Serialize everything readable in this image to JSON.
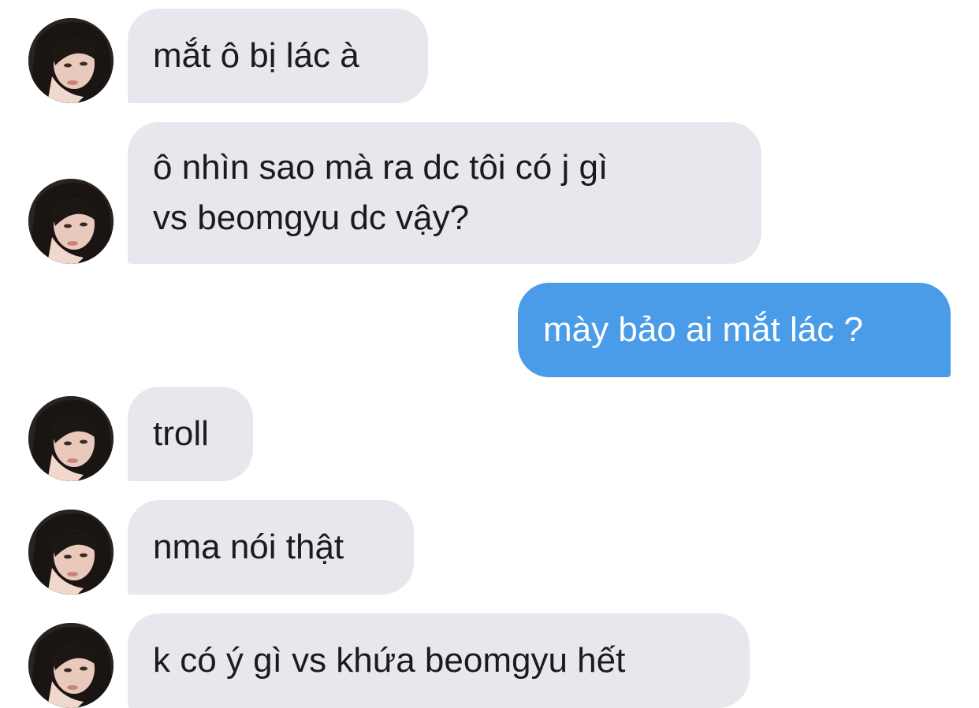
{
  "messages": [
    {
      "sender": "other",
      "lines": [
        "mắt ô bị lác à"
      ]
    },
    {
      "sender": "other",
      "lines": [
        "ô nhìn sao mà ra dc tôi có j gì",
        "vs beomgyu dc vậy?"
      ]
    },
    {
      "sender": "me",
      "lines": [
        "mày bảo ai mắt lác ?"
      ]
    },
    {
      "sender": "other",
      "lines": [
        "troll"
      ]
    },
    {
      "sender": "other",
      "lines": [
        "nma nói thật"
      ]
    },
    {
      "sender": "other",
      "lines": [
        "k có ý gì vs khứa beomgyu hết"
      ]
    }
  ],
  "colors": {
    "incoming_bubble": "#e6e8ed",
    "outgoing_bubble": "#4a9be8",
    "incoming_text": "#1b1b1f",
    "outgoing_text": "#ffffff"
  },
  "icons": {
    "avatar": "profile-photo-avatar"
  }
}
